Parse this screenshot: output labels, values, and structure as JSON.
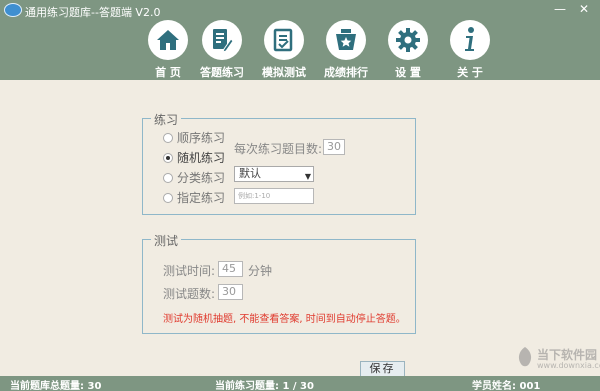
{
  "window": {
    "title": "通用练习题库--答题端 V2.0",
    "min_label": "—",
    "close_label": "✕"
  },
  "nav": [
    {
      "label": "首  页",
      "icon": "home-icon"
    },
    {
      "label": "答题练习",
      "icon": "document-edit-icon"
    },
    {
      "label": "模拟测试",
      "icon": "exam-icon"
    },
    {
      "label": "成绩排行",
      "icon": "ranking-icon"
    },
    {
      "label": "设  置",
      "icon": "gear-icon"
    },
    {
      "label": "关  于",
      "icon": "info-icon"
    }
  ],
  "practice": {
    "title": "练习",
    "options": [
      "顺序练习",
      "随机练习",
      "分类练习",
      "指定练习"
    ],
    "selected": "随机练习",
    "per_count_label": "每次练习题目数:",
    "per_count_value": "30",
    "category_value": "默认",
    "specify_placeholder": "例如:1-10"
  },
  "test": {
    "title": "测试",
    "time_label": "测试时间:",
    "time_value": "45",
    "time_unit": "分钟",
    "count_label": "测试题数:",
    "count_value": "30",
    "note": "测试为随机抽题, 不能查看答案, 时间到自动停止答题。"
  },
  "save_label": "保存",
  "status": {
    "total": "当前题库总题量: 30",
    "current": "当前练习题量: 1 / 30",
    "student": "学员姓名: 001"
  },
  "watermark": {
    "line1": "当下软件园",
    "line2": "www.downxia.com"
  },
  "colors": {
    "header_bg": "#7e9682",
    "body_bg": "#f1ece2",
    "icon_color": "#2f6f7e",
    "note_color": "#e03a2e"
  }
}
